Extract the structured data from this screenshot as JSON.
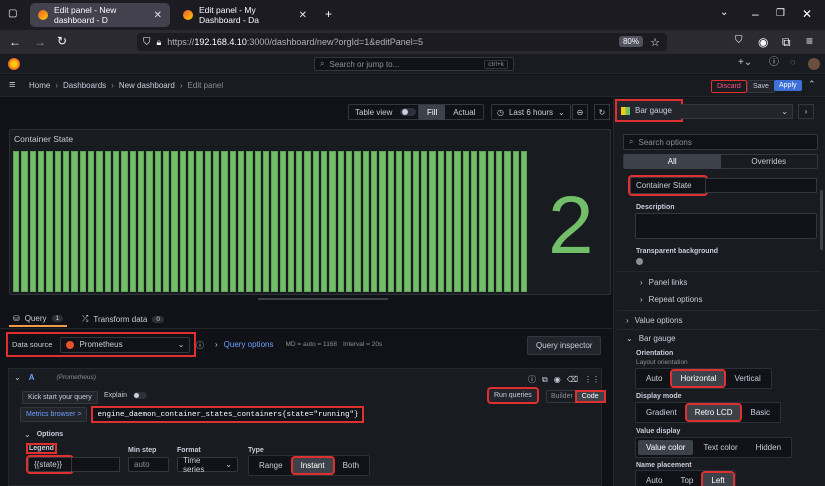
{
  "browser": {
    "tabs": [
      {
        "label": "Edit panel - New dashboard - D",
        "active": true
      },
      {
        "label": "Edit panel - My Dashboard - Da",
        "active": false
      }
    ],
    "new_tab_symbol": "+",
    "url_prefix": "https://",
    "url_host": "192.168.4.10",
    "url_rest": ":3000/dashboard/new?orgId=1&editPanel=5",
    "zoom": "80%"
  },
  "grafana": {
    "search_placeholder": "Search or jump to...",
    "search_shortcut": "ctrl+k",
    "breadcrumbs": [
      "Home",
      "Dashboards",
      "New dashboard",
      "Edit panel"
    ],
    "discard_label": "Discard",
    "save_label": "Save",
    "apply_label": "Apply",
    "accent_color": "#3d71d9"
  },
  "toolbar": {
    "table_view_label": "Table view",
    "fill_label": "Fill",
    "actual_label": "Actual",
    "time_range": "Last 6 hours"
  },
  "panel": {
    "title": "Container State",
    "value": "2",
    "value_color": "#73bf69",
    "bar_count": 62
  },
  "query_tabs": {
    "query_label": "Query",
    "query_count": "1",
    "transform_label": "Transform data",
    "transform_count": "0"
  },
  "datasource": {
    "label": "Data source",
    "value": "Prometheus",
    "query_options_label": "Query options",
    "md_text": "MD = auto = 1168",
    "interval_text": "Interval = 20s",
    "inspector_label": "Query inspector"
  },
  "query": {
    "ref": "A",
    "source_note": "(Prometheus)",
    "kick_start_label": "Kick start your query",
    "explain_label": "Explain",
    "run_queries_label": "Run queries",
    "builder_label": "Builder",
    "code_label": "Code",
    "metrics_browser_label": "Metrics browser >",
    "expression": "engine_daemon_container_states_containers{state=\"running\"}",
    "options_label": "Options",
    "legend_label": "Legend",
    "legend_value": "{{state}}",
    "min_step_label": "Min step",
    "min_step_placeholder": "auto",
    "format_label": "Format",
    "format_value": "Time series",
    "type_label": "Type",
    "type_options": [
      "Range",
      "Instant",
      "Both"
    ],
    "type_selected": "Instant"
  },
  "options_pane": {
    "visualization": "Bar gauge",
    "search_placeholder": "Search options",
    "tab_all": "All",
    "tab_overrides": "Overrides",
    "title_value": "Container State",
    "description_label": "Description",
    "transparent_label": "Transparent background",
    "panel_links_label": "Panel links",
    "repeat_options_label": "Repeat options",
    "value_options_label": "Value options",
    "bar_gauge_label": "Bar gauge",
    "orientation_label": "Orientation",
    "orientation_sub": "Layout orientation",
    "orientation_options": [
      "Auto",
      "Horizontal",
      "Vertical"
    ],
    "display_mode_label": "Display mode",
    "display_mode_options": [
      "Gradient",
      "Retro LCD",
      "Basic"
    ],
    "value_display_label": "Value display",
    "value_display_options": [
      "Value color",
      "Text color",
      "Hidden"
    ],
    "name_placement_label": "Name placement",
    "name_placement_options": [
      "Auto",
      "Top",
      "Left"
    ]
  }
}
